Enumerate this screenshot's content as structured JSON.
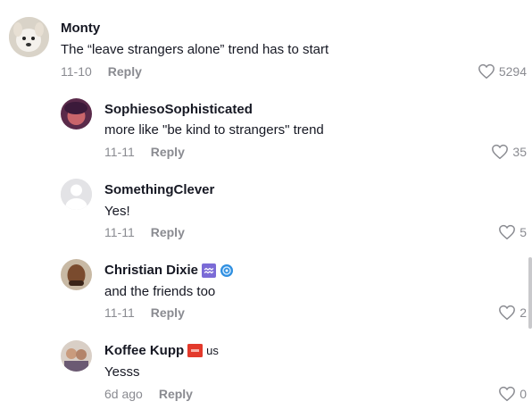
{
  "comments": [
    {
      "user": "Monty",
      "text": "The “leave strangers alone” trend has to start",
      "date": "11-10",
      "reply_label": "Reply",
      "likes": "5294"
    },
    {
      "user": "SophiesoSophisticated",
      "text": "more like \"be kind to strangers\" trend",
      "date": "11-11",
      "reply_label": "Reply",
      "likes": "35"
    },
    {
      "user": "SomethingClever",
      "text": "Yes!",
      "date": "11-11",
      "reply_label": "Reply",
      "likes": "5"
    },
    {
      "user": "Christian Dixie",
      "text": "and the friends too",
      "date": "11-11",
      "reply_label": "Reply",
      "likes": "2",
      "badges": [
        "aquarius-badge-icon",
        "blue-spiral-badge-icon"
      ]
    },
    {
      "user": "Koffee Kupp",
      "text": "Yesss",
      "date": "6d ago",
      "reply_label": "Reply",
      "likes": "0",
      "flag_text": "us",
      "badges": [
        "red-flag-badge-icon"
      ]
    }
  ],
  "colors": {
    "text": "#161823",
    "muted": "#8a8b91",
    "aquarius": "#7b6bd6",
    "spiral": "#2f8fe0",
    "flag": "#e3392b"
  }
}
